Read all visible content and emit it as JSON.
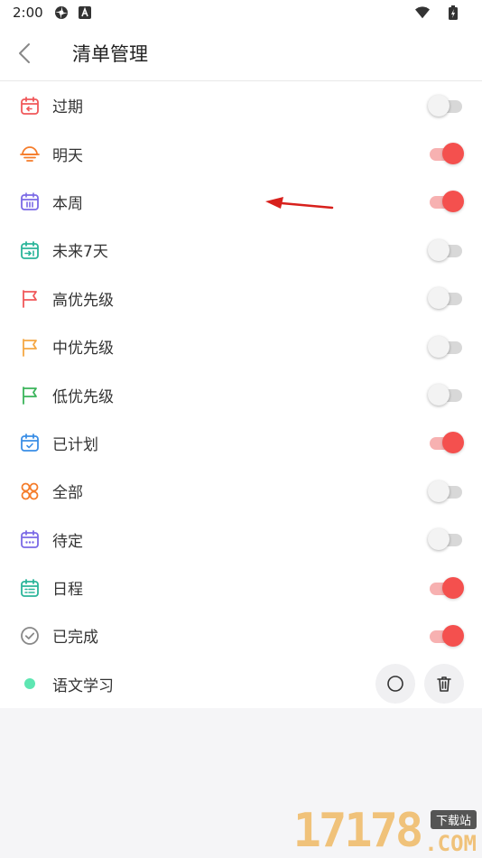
{
  "status_bar": {
    "time": "2:00"
  },
  "header": {
    "title": "清单管理"
  },
  "lists": [
    {
      "label": "过期",
      "icon": "calendar-overdue-icon",
      "color": "#f0585a",
      "enabled": false
    },
    {
      "label": "明天",
      "icon": "sunrise-icon",
      "color": "#f57c2a",
      "enabled": true
    },
    {
      "label": "本周",
      "icon": "calendar-week-icon",
      "color": "#7b6ae6",
      "enabled": true
    },
    {
      "label": "未来7天",
      "icon": "calendar-next-icon",
      "color": "#2bb59a",
      "enabled": false
    },
    {
      "label": "高优先级",
      "icon": "flag-high-icon",
      "color": "#f0585a",
      "enabled": false
    },
    {
      "label": "中优先级",
      "icon": "flag-medium-icon",
      "color": "#f5a743",
      "enabled": false
    },
    {
      "label": "低优先级",
      "icon": "flag-low-icon",
      "color": "#3ab45a",
      "enabled": false
    },
    {
      "label": "已计划",
      "icon": "calendar-check-icon",
      "color": "#3a8ee6",
      "enabled": true
    },
    {
      "label": "全部",
      "icon": "grid-circles-icon",
      "color": "#f57c2a",
      "enabled": false
    },
    {
      "label": "待定",
      "icon": "calendar-dots-icon",
      "color": "#7b6ae6",
      "enabled": false
    },
    {
      "label": "日程",
      "icon": "calendar-schedule-icon",
      "color": "#2bb59a",
      "enabled": true
    },
    {
      "label": "已完成",
      "icon": "check-circle-icon",
      "color": "#888888",
      "enabled": true
    }
  ],
  "custom_list": {
    "label": "语文学习",
    "color": "#5ee6b2"
  },
  "watermark": {
    "number": "17178",
    "tag": "下载站",
    "domain": ".COM"
  },
  "colors": {
    "accent": "#f4504e",
    "accent_track": "#f7b1b1"
  }
}
